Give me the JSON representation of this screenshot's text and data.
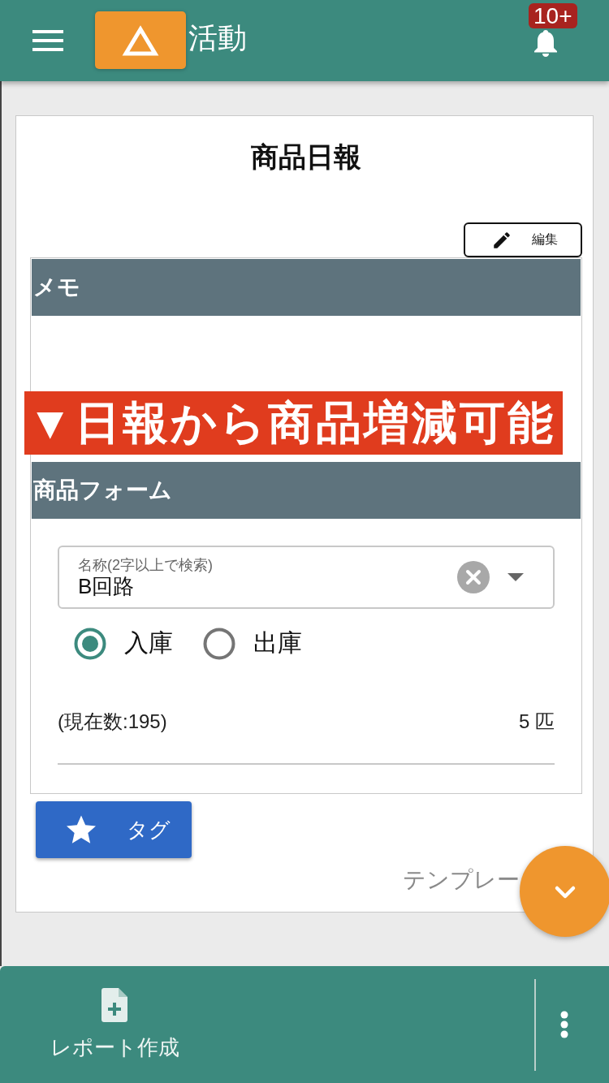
{
  "header": {
    "title": "活動",
    "notification_badge": "10+"
  },
  "card": {
    "title": "商品日報",
    "edit_button": "編集"
  },
  "memo_section": {
    "heading": "メモ"
  },
  "annotation": {
    "text": "▼日報から商品増減可能"
  },
  "product_form": {
    "heading": "商品フォーム",
    "name_field": {
      "label": "名称(2字以上で検索)",
      "value": "B回路"
    },
    "direction_options": [
      {
        "label": "入庫",
        "selected": true
      },
      {
        "label": "出庫",
        "selected": false
      }
    ],
    "current_stock": "(現在数:195)",
    "quantity": "5 匹"
  },
  "tag_button": "タグ",
  "template_link": "テンプレー",
  "bottom_bar": {
    "actions": [
      {
        "label": "レポート作成"
      }
    ]
  }
}
